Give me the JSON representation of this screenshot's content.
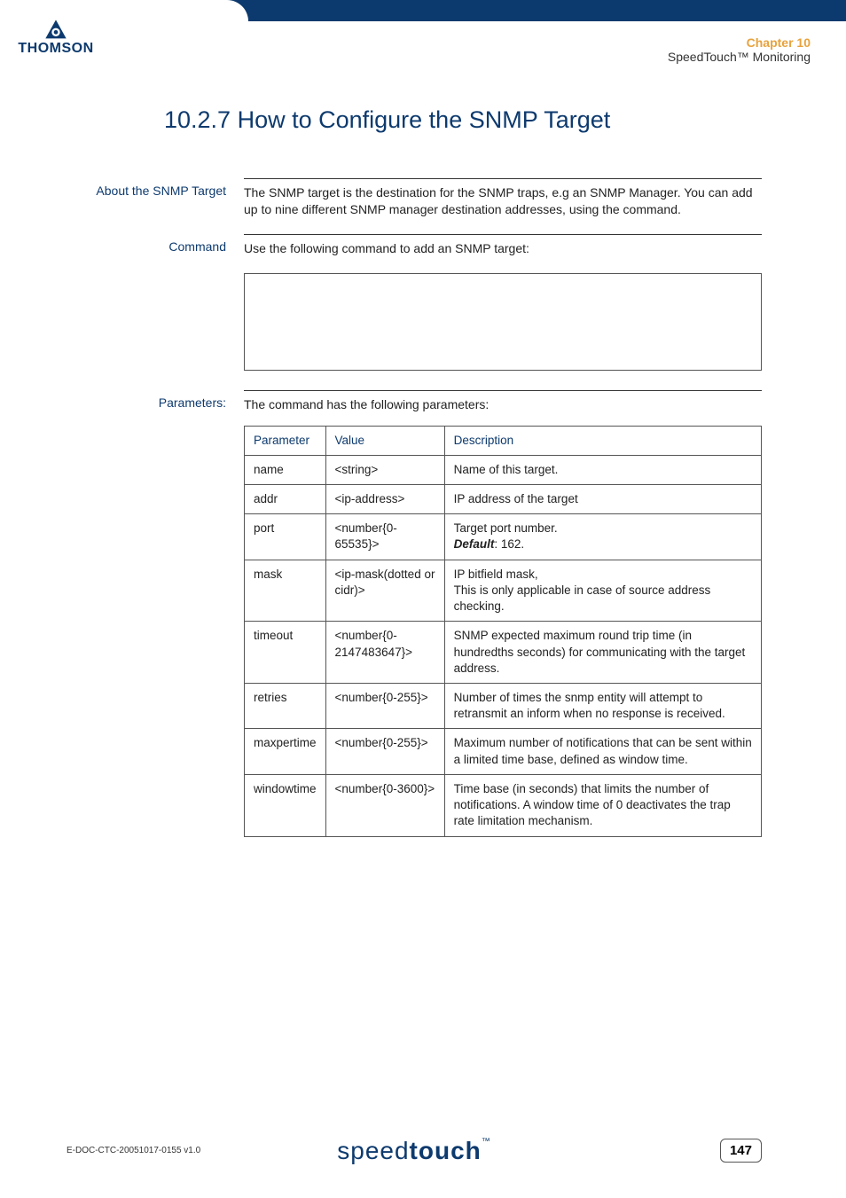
{
  "logo": {
    "text": "THOMSON"
  },
  "header": {
    "chapter_label": "Chapter 10",
    "chapter_sub": "SpeedTouch™ Monitoring"
  },
  "title": "10.2.7   How to Configure the SNMP Target",
  "sections": {
    "about": {
      "label": "About the SNMP Target",
      "body": "The SNMP target is the destination for the SNMP traps, e.g an SNMP Manager. You can add up to nine different SNMP manager destination addresses, using the command."
    },
    "command": {
      "label": "Command",
      "body": "Use the following command to add an SNMP target:"
    },
    "parameters": {
      "label": "Parameters:",
      "body": "The command has the following parameters:",
      "headers": {
        "p": "Parameter",
        "v": "Value",
        "d": "Description"
      },
      "rows": [
        {
          "p": "name",
          "v": "<string>",
          "d": "Name of this target."
        },
        {
          "p": "addr",
          "v": "<ip-address>",
          "d": "IP address of the target"
        },
        {
          "p": "port",
          "v": "<number{0-65535}>",
          "d_pre": "Target port number.",
          "d_def_label": "Default",
          "d_def_val": ": 162."
        },
        {
          "p": "mask",
          "v": "<ip-mask(dotted or cidr)>",
          "d": "IP bitfield mask,\nThis is only applicable in case of source address checking."
        },
        {
          "p": "timeout",
          "v": "<number{0-2147483647}>",
          "d": "SNMP expected maximum round trip time (in hundredths seconds) for communicating with the target address."
        },
        {
          "p": "retries",
          "v": "<number{0-255}>",
          "d": "Number of times the snmp entity will attempt to retransmit an inform when no response is received."
        },
        {
          "p": "maxpertime",
          "v": "<number{0-255}>",
          "d": "Maximum number of notifications that can be sent within a limited time base, defined as window time."
        },
        {
          "p": "windowtime",
          "v": "<number{0-3600}>",
          "d": "Time base (in seconds) that limits the number of notifications. A window time of 0 deactivates the trap rate limitation mechanism."
        }
      ]
    }
  },
  "footer": {
    "doc_id": "E-DOC-CTC-20051017-0155 v1.0",
    "brand_light": "speed",
    "brand_bold": "touch",
    "brand_tm": "™",
    "page": "147"
  }
}
